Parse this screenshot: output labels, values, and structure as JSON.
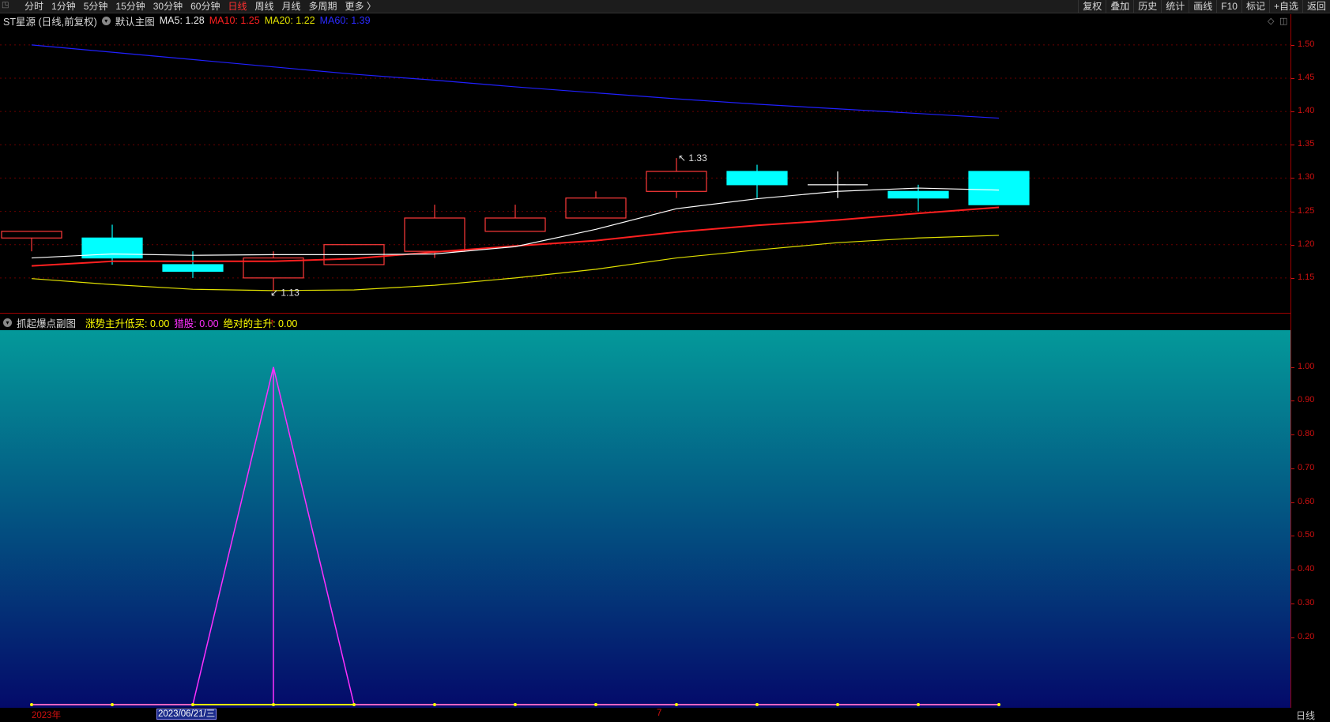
{
  "toolbar": {
    "periods": [
      "分时",
      "1分钟",
      "5分钟",
      "15分钟",
      "30分钟",
      "60分钟",
      "日线",
      "周线",
      "月线",
      "多周期",
      "更多 〉"
    ],
    "active_period": "日线",
    "right_menu": [
      "复权",
      "叠加",
      "历史",
      "统计",
      "画线",
      "F10",
      "标记",
      "+自选",
      "返回"
    ]
  },
  "main_legend": {
    "stock": "ST星源 (日线,前复权)",
    "template": "默认主图",
    "ma5_label": "MA5: 1.28",
    "ma10_label": "MA10: 1.25",
    "ma20_label": "MA20: 1.22",
    "ma60_label": "MA60: 1.39"
  },
  "sub_legend": {
    "title": "抓起爆点副图",
    "item1": "涨势主升低买: 0.00",
    "item2": "猎股: 0.00",
    "item3": "绝对的主升: 0.00"
  },
  "annotations": {
    "high": "1.33",
    "low": "1.13"
  },
  "bottom": {
    "year": "2023年",
    "date": "2023/06/21/三",
    "month": "7",
    "period": "日线"
  },
  "colors": {
    "up": "#ff3a3a",
    "down": "#00ffff",
    "ma5": "#ffffff",
    "ma10": "#ff2020",
    "ma20": "#e0e000",
    "ma60": "#2020ff",
    "magenta": "#ff30ff",
    "yellow": "#ffff00"
  },
  "chart_data": [
    {
      "type": "candlestick",
      "y_range": [
        1.1,
        1.52
      ],
      "y_ticks": [
        "1.50",
        "1.45",
        "1.40",
        "1.35",
        "1.30",
        "1.25",
        "1.20",
        "1.15"
      ],
      "candles": [
        {
          "open": 1.21,
          "close": 1.22,
          "high": 1.22,
          "low": 1.19
        },
        {
          "open": 1.21,
          "close": 1.18,
          "high": 1.23,
          "low": 1.17
        },
        {
          "open": 1.17,
          "close": 1.16,
          "high": 1.19,
          "low": 1.15
        },
        {
          "open": 1.15,
          "close": 1.18,
          "high": 1.19,
          "low": 1.13
        },
        {
          "open": 1.17,
          "close": 1.2,
          "high": 1.2,
          "low": 1.17
        },
        {
          "open": 1.19,
          "close": 1.24,
          "high": 1.26,
          "low": 1.18
        },
        {
          "open": 1.22,
          "close": 1.24,
          "high": 1.26,
          "low": 1.22
        },
        {
          "open": 1.24,
          "close": 1.27,
          "high": 1.28,
          "low": 1.24
        },
        {
          "open": 1.28,
          "close": 1.31,
          "high": 1.33,
          "low": 1.27
        },
        {
          "open": 1.31,
          "close": 1.29,
          "high": 1.32,
          "low": 1.27
        },
        {
          "open": 1.29,
          "close": 1.29,
          "high": 1.31,
          "low": 1.27
        },
        {
          "open": 1.28,
          "close": 1.27,
          "high": 1.29,
          "low": 1.25
        },
        {
          "open": 1.31,
          "close": 1.26,
          "high": 1.31,
          "low": 1.26
        }
      ],
      "ma5": [
        1.18,
        1.186,
        1.184,
        1.185,
        1.185,
        1.186,
        1.197,
        1.223,
        1.254,
        1.269,
        1.28,
        1.285,
        1.282
      ],
      "ma10": [
        1.168,
        1.175,
        1.175,
        1.175,
        1.179,
        1.189,
        1.198,
        1.206,
        1.219,
        1.229,
        1.237,
        1.247,
        1.256
      ],
      "ma20": [
        1.149,
        1.14,
        1.133,
        1.131,
        1.132,
        1.139,
        1.15,
        1.163,
        1.18,
        1.192,
        1.203,
        1.21,
        1.214
      ],
      "ma60": [
        1.5,
        1.489,
        1.478,
        1.467,
        1.456,
        1.447,
        1.437,
        1.428,
        1.419,
        1.411,
        1.404,
        1.397,
        1.39
      ]
    },
    {
      "type": "line",
      "y_range": [
        0.0,
        1.1
      ],
      "y_ticks": [
        "1.00",
        "0.90",
        "0.80",
        "0.70",
        "0.60",
        "0.50",
        "0.40",
        "0.30",
        "0.20"
      ],
      "series": [
        {
          "values": [
            0,
            0,
            0,
            1,
            0,
            0,
            0,
            0,
            0,
            0,
            0,
            0,
            0
          ]
        },
        {
          "values": [
            0,
            0,
            0,
            0,
            0,
            0,
            0,
            0,
            0,
            0,
            0,
            0,
            0
          ]
        }
      ]
    }
  ]
}
